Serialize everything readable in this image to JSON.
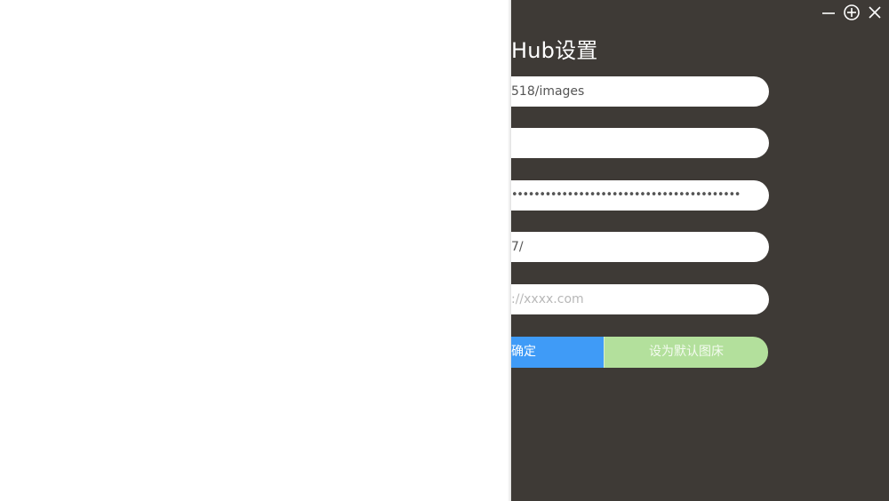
{
  "panel": {
    "title": "Hub设置",
    "fields": [
      {
        "value": "518/images",
        "placeholder": ""
      },
      {
        "value": "",
        "placeholder": ""
      },
      {
        "masked": "•••••••••••••••••••••••••••••••••••••••••"
      },
      {
        "value": "7/",
        "placeholder": ""
      },
      {
        "value": "",
        "placeholder": "://xxxx.com"
      }
    ],
    "buttons": {
      "confirm": "确定",
      "set_default": "设为默认图床"
    }
  },
  "window_controls": {
    "minimize_icon": "minimize-icon",
    "maximize_icon": "circle-plus-icon",
    "close_icon": "close-icon"
  },
  "colors": {
    "panel_bg": "#3e3a36",
    "confirm_button": "#3f9bf7",
    "default_button": "#b3e09c"
  }
}
